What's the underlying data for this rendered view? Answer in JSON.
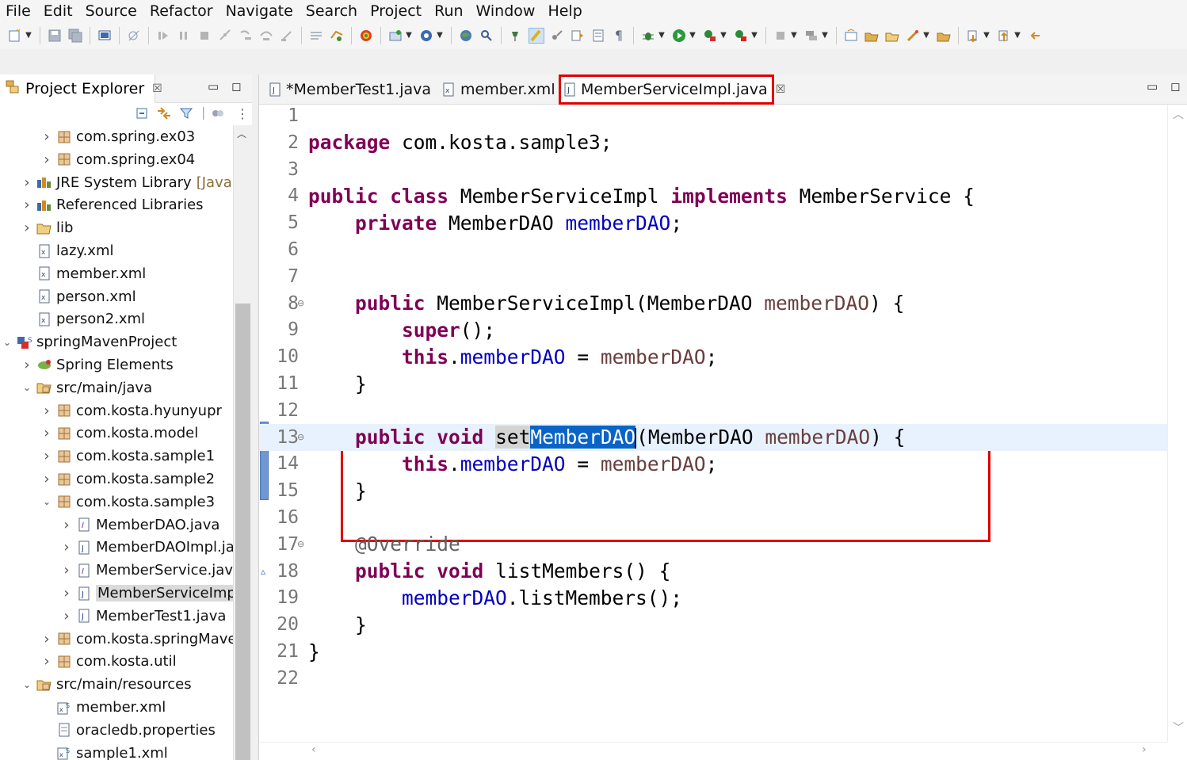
{
  "menu": [
    "File",
    "Edit",
    "Source",
    "Refactor",
    "Navigate",
    "Search",
    "Project",
    "Run",
    "Window",
    "Help"
  ],
  "explorer": {
    "title": "Project Explorer",
    "tree": [
      {
        "label": "com.spring.ex03",
        "depth": 2,
        "expanded": false,
        "icon": "package-icon"
      },
      {
        "label": "com.spring.ex04",
        "depth": 2,
        "expanded": false,
        "icon": "package-icon"
      },
      {
        "label": "JRE System Library",
        "decoration": "[JavaS",
        "depth": 1,
        "expanded": false,
        "icon": "library-icon"
      },
      {
        "label": "Referenced Libraries",
        "depth": 1,
        "expanded": false,
        "icon": "library-icon"
      },
      {
        "label": "lib",
        "depth": 1,
        "expanded": false,
        "icon": "folder-icon"
      },
      {
        "label": "lazy.xml",
        "depth": 1,
        "expanded": null,
        "icon": "xml-file-icon"
      },
      {
        "label": "member.xml",
        "depth": 1,
        "expanded": null,
        "icon": "xml-file-icon"
      },
      {
        "label": "person.xml",
        "depth": 1,
        "expanded": null,
        "icon": "xml-file-icon"
      },
      {
        "label": "person2.xml",
        "depth": 1,
        "expanded": null,
        "icon": "xml-file-icon"
      },
      {
        "label": "springMavenProject",
        "depth": 0,
        "expanded": true,
        "icon": "spring-project-icon"
      },
      {
        "label": "Spring Elements",
        "depth": 1,
        "expanded": false,
        "icon": "spring-elements-icon"
      },
      {
        "label": "src/main/java",
        "depth": 1,
        "expanded": true,
        "icon": "source-folder-icon"
      },
      {
        "label": "com.kosta.hyunyupr",
        "depth": 2,
        "expanded": false,
        "icon": "package-icon"
      },
      {
        "label": "com.kosta.model",
        "depth": 2,
        "expanded": false,
        "icon": "package-icon"
      },
      {
        "label": "com.kosta.sample1",
        "depth": 2,
        "expanded": false,
        "icon": "package-icon"
      },
      {
        "label": "com.kosta.sample2",
        "depth": 2,
        "expanded": false,
        "icon": "package-icon"
      },
      {
        "label": "com.kosta.sample3",
        "depth": 2,
        "expanded": true,
        "icon": "package-icon"
      },
      {
        "label": "MemberDAO.java",
        "depth": 3,
        "expanded": false,
        "icon": "java-interface-icon"
      },
      {
        "label": "MemberDAOImpl.ja",
        "depth": 3,
        "expanded": false,
        "icon": "java-file-icon"
      },
      {
        "label": "MemberService.java",
        "depth": 3,
        "expanded": false,
        "icon": "java-interface-icon"
      },
      {
        "label": "MemberServiceImp",
        "depth": 3,
        "expanded": false,
        "icon": "java-file-icon",
        "selected": true
      },
      {
        "label": "MemberTest1.java",
        "depth": 3,
        "expanded": false,
        "icon": "java-file-icon"
      },
      {
        "label": "com.kosta.springMave",
        "depth": 2,
        "expanded": false,
        "icon": "package-icon"
      },
      {
        "label": "com.kosta.util",
        "depth": 2,
        "expanded": false,
        "icon": "package-icon"
      },
      {
        "label": "src/main/resources",
        "depth": 1,
        "expanded": true,
        "icon": "source-folder-icon"
      },
      {
        "label": "member.xml",
        "depth": 2,
        "expanded": null,
        "icon": "spring-xml-icon"
      },
      {
        "label": "oracledb.properties",
        "depth": 2,
        "expanded": null,
        "icon": "properties-file-icon"
      },
      {
        "label": "sample1.xml",
        "depth": 2,
        "expanded": null,
        "icon": "spring-xml-icon"
      }
    ]
  },
  "editor": {
    "tabs": [
      {
        "label": "*MemberTest1.java",
        "icon": "java-file-icon",
        "active": false
      },
      {
        "label": "member.xml",
        "icon": "xml-file-icon",
        "active": false
      },
      {
        "label": "MemberServiceImpl.java",
        "icon": "java-file-icon",
        "active": true,
        "highlighted": true
      }
    ],
    "lines": [
      {
        "n": "1",
        "tokens": []
      },
      {
        "n": "2",
        "tokens": [
          [
            "kw",
            "package"
          ],
          [
            "t",
            " com.kosta.sample3;"
          ]
        ]
      },
      {
        "n": "3",
        "tokens": []
      },
      {
        "n": "4",
        "tokens": [
          [
            "kw",
            "public"
          ],
          [
            "t",
            " "
          ],
          [
            "kw",
            "class"
          ],
          [
            "t",
            " MemberServiceImpl "
          ],
          [
            "kw",
            "implements"
          ],
          [
            "t",
            " MemberService {"
          ]
        ]
      },
      {
        "n": "5",
        "tokens": [
          [
            "t",
            "    "
          ],
          [
            "kw",
            "private"
          ],
          [
            "t",
            " MemberDAO "
          ],
          [
            "fld",
            "memberDAO"
          ],
          [
            "t",
            ";"
          ]
        ]
      },
      {
        "n": "6",
        "tokens": []
      },
      {
        "n": "7",
        "tokens": []
      },
      {
        "n": "8",
        "fold": true,
        "tokens": [
          [
            "t",
            "    "
          ],
          [
            "kw",
            "public"
          ],
          [
            "t",
            " MemberServiceImpl(MemberDAO "
          ],
          [
            "prm",
            "memberDAO"
          ],
          [
            "t",
            ") {"
          ]
        ]
      },
      {
        "n": "9",
        "tokens": [
          [
            "t",
            "        "
          ],
          [
            "kw",
            "super"
          ],
          [
            "t",
            "();"
          ]
        ]
      },
      {
        "n": "10",
        "tokens": [
          [
            "t",
            "        "
          ],
          [
            "kw",
            "this"
          ],
          [
            "t",
            "."
          ],
          [
            "fld",
            "memberDAO"
          ],
          [
            "t",
            " = "
          ],
          [
            "prm",
            "memberDAO"
          ],
          [
            "t",
            ";"
          ]
        ]
      },
      {
        "n": "11",
        "tokens": [
          [
            "t",
            "    }"
          ]
        ]
      },
      {
        "n": "12",
        "tokens": []
      },
      {
        "n": "13",
        "fold": true,
        "current": true,
        "tokens": [
          [
            "t",
            "    "
          ],
          [
            "kw",
            "public"
          ],
          [
            "t",
            " "
          ],
          [
            "kw",
            "void"
          ],
          [
            "t",
            " "
          ],
          [
            "occ",
            "set"
          ],
          [
            "sel",
            "MemberDAO"
          ],
          [
            "caret",
            ""
          ],
          [
            "t",
            "(MemberDAO "
          ],
          [
            "prm",
            "memberDAO"
          ],
          [
            "t",
            ") {"
          ]
        ]
      },
      {
        "n": "14",
        "tokens": [
          [
            "t",
            "        "
          ],
          [
            "kw",
            "this"
          ],
          [
            "t",
            "."
          ],
          [
            "fld",
            "memberDAO"
          ],
          [
            "t",
            " = "
          ],
          [
            "prm",
            "memberDAO"
          ],
          [
            "t",
            ";"
          ]
        ]
      },
      {
        "n": "15",
        "tokens": [
          [
            "t",
            "    }"
          ]
        ]
      },
      {
        "n": "16",
        "tokens": []
      },
      {
        "n": "17",
        "fold": true,
        "tokens": [
          [
            "t",
            "    "
          ],
          [
            "ann",
            "@Override"
          ]
        ]
      },
      {
        "n": "18",
        "override": true,
        "tokens": [
          [
            "t",
            "    "
          ],
          [
            "kw",
            "public"
          ],
          [
            "t",
            " "
          ],
          [
            "kw",
            "void"
          ],
          [
            "t",
            " listMembers() {"
          ]
        ]
      },
      {
        "n": "19",
        "tokens": [
          [
            "t",
            "        "
          ],
          [
            "fld",
            "memberDAO"
          ],
          [
            "t",
            ".listMembers();"
          ]
        ]
      },
      {
        "n": "20",
        "tokens": [
          [
            "t",
            "    }"
          ]
        ]
      },
      {
        "n": "21",
        "tokens": [
          [
            "t",
            "}"
          ]
        ]
      },
      {
        "n": "22",
        "tokens": []
      }
    ]
  },
  "colors": {
    "keyword": "#7f0055",
    "field": "#0000c0",
    "parameter": "#6a3e3e",
    "annotation": "#646464",
    "selection": "#0a64c8",
    "highlight_box": "#e00000",
    "current_line": "#e8f2fe"
  }
}
